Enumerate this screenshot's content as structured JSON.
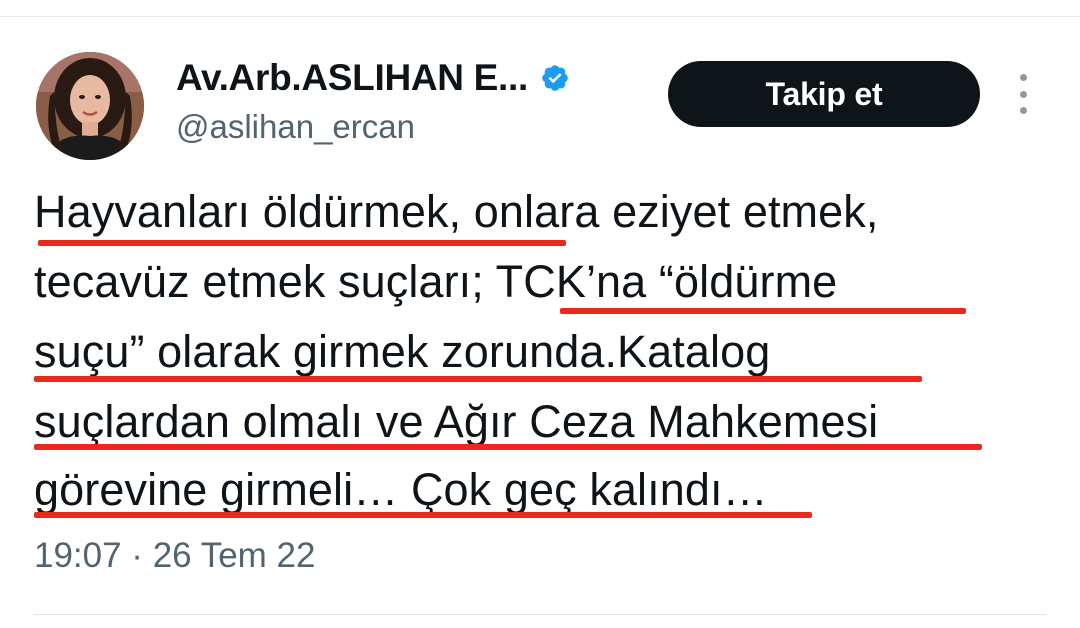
{
  "author": {
    "display_name": "Av.Arb.ASLIHAN E...",
    "handle": "@aslihan_ercan",
    "verified_color": "#1d9bf0"
  },
  "actions": {
    "follow_label": "Takip et",
    "more_icon": "more-vertical-icon"
  },
  "tweet": {
    "lines": [
      "Hayvanları öldürmek, onlara eziyet etmek,",
      "tecavüz etmek suçları; TCK’na “öldürme",
      "suçu” olarak girmek zorunda.Katalog",
      "suçlardan olmalı ve Ağır Ceza Mahkemesi",
      "görevine girmeli… Çok geç kalındı…"
    ],
    "timestamp": "19:07 · 26 Tem 22"
  },
  "colors": {
    "underline": "#e8291c",
    "text": "#0f1419",
    "secondary": "#536471",
    "button_bg": "#0f1419"
  }
}
